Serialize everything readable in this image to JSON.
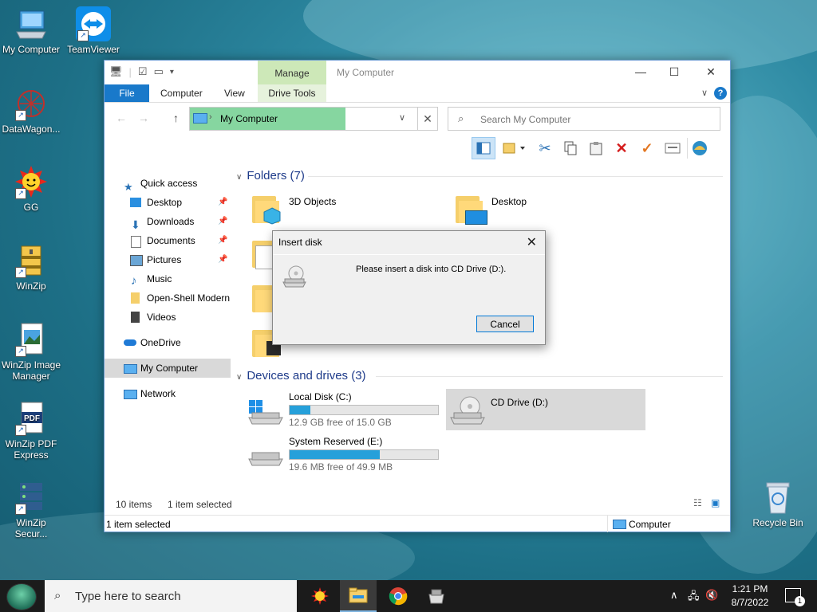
{
  "desktop": {
    "icons": [
      {
        "label": "My Computer"
      },
      {
        "label": "TeamViewer"
      },
      {
        "label": "DataWagon..."
      },
      {
        "label": "GG"
      },
      {
        "label": "WinZip"
      },
      {
        "label": "WinZip Image Manager"
      },
      {
        "label": "WinZip PDF Express"
      },
      {
        "label": "WinZip Secur..."
      },
      {
        "label": "Recycle Bin"
      }
    ]
  },
  "window": {
    "title": "My Computer",
    "context_tab": "Manage",
    "tabs": [
      "File",
      "Computer",
      "View",
      "Drive Tools"
    ],
    "address": "My Computer",
    "search_placeholder": "Search My Computer"
  },
  "nav": {
    "items": [
      {
        "label": "Quick access"
      },
      {
        "label": "Desktop"
      },
      {
        "label": "Downloads"
      },
      {
        "label": "Documents"
      },
      {
        "label": "Pictures"
      },
      {
        "label": "Music"
      },
      {
        "label": "Open-Shell Modern"
      },
      {
        "label": "Videos"
      },
      {
        "label": "OneDrive"
      },
      {
        "label": "My Computer"
      },
      {
        "label": "Network"
      }
    ]
  },
  "content": {
    "folders_header": "Folders (7)",
    "folders": [
      {
        "name": "3D Objects"
      },
      {
        "name": "Desktop"
      }
    ],
    "devices_header": "Devices and drives (3)",
    "drives": [
      {
        "name": "Local Disk (C:)",
        "free": "12.9 GB free of 15.0 GB",
        "used_fraction": 0.14
      },
      {
        "name": "CD Drive (D:)"
      },
      {
        "name": "System Reserved (E:)",
        "free": "19.6 MB free of 49.9 MB",
        "used_fraction": 0.61
      }
    ]
  },
  "status": {
    "items": "10 items",
    "selected": "1 item selected",
    "bottom_left": "1 item selected",
    "bottom_right": "Computer"
  },
  "dialog": {
    "title": "Insert disk",
    "message": "Please insert a disk into CD Drive (D:).",
    "cancel": "Cancel"
  },
  "taskbar": {
    "search_placeholder": "Type here to search",
    "time": "1:21 PM",
    "date": "8/7/2022",
    "notification_count": "1"
  },
  "colors": {
    "accent": "#1979ca",
    "manage_tab": "#cde8b8",
    "address_highlight": "#86d6a0",
    "drive_bar": "#26a0da"
  }
}
